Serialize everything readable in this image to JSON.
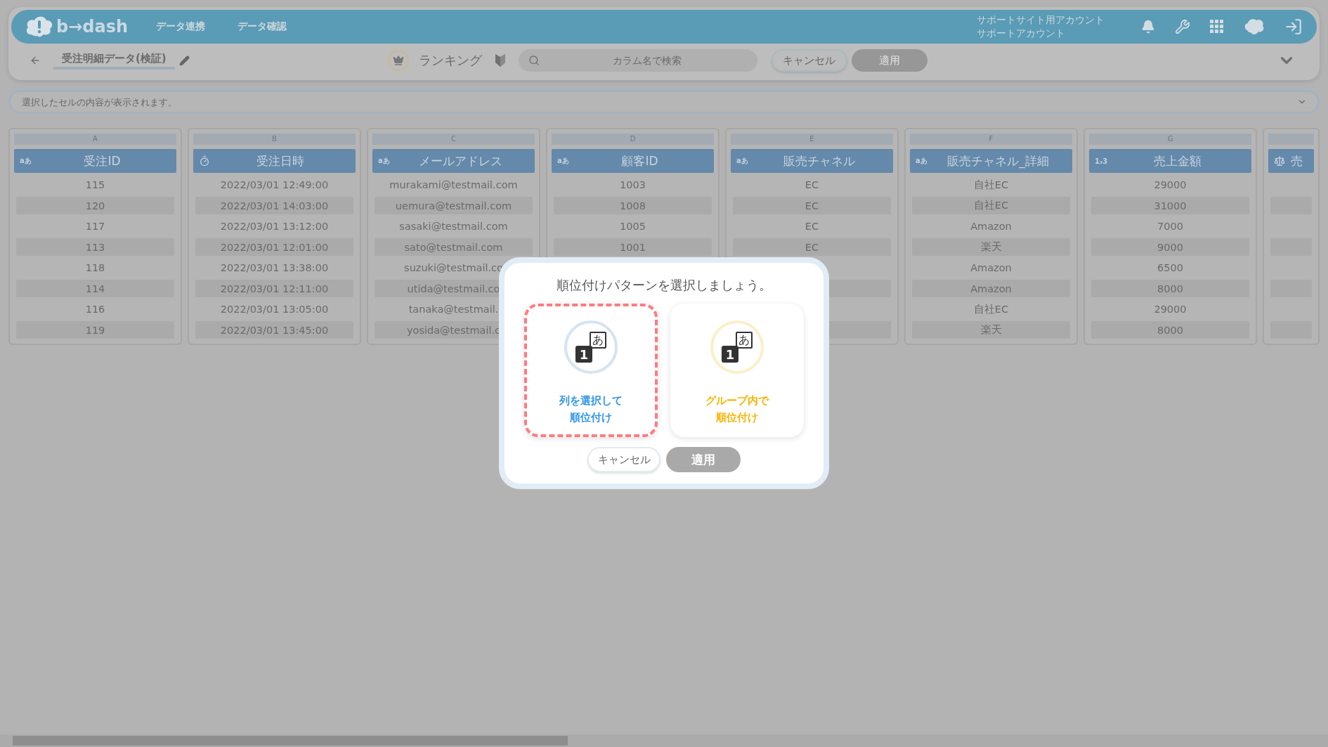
{
  "header": {
    "logo_text": "b→dash",
    "nav": [
      "データ連携",
      "データ確認"
    ],
    "account": [
      "サポートサイト用アカウント",
      "サポートアカウント"
    ]
  },
  "toolbar": {
    "title": "受注明細データ(検証)",
    "mode": "ランキング",
    "search": {
      "placeholder": "カラム名で検索"
    },
    "buttons": [
      {
        "label": "キャンセル",
        "disabled": false
      },
      {
        "label": "適用",
        "disabled": true
      }
    ]
  },
  "cell_preview": {
    "placeholder": "選択したセルの内容が表示されます。"
  },
  "table": {
    "columns": [
      {
        "letter": "A",
        "name": "受注ID",
        "kind": "text",
        "badge": "aあ",
        "cells": [
          "115",
          "120",
          "117",
          "113",
          "118",
          "114",
          "116",
          "119"
        ]
      },
      {
        "letter": "B",
        "name": "受注日時",
        "kind": "datetime",
        "cells": [
          "2022/03/01 12:49:00",
          "2022/03/01 14:03:00",
          "2022/03/01 13:12:00",
          "2022/03/01 12:01:00",
          "2022/03/01 13:38:00",
          "2022/03/01 12:11:00",
          "2022/03/01 13:05:00",
          "2022/03/01 13:45:00"
        ]
      },
      {
        "letter": "C",
        "name": "メールアドレス",
        "kind": "text",
        "badge": "aあ",
        "cells": [
          "murakami@testmail.com",
          "uemura@testmail.com",
          "sasaki@testmail.com",
          "sato@testmail.com",
          "suzuki@testmail.co",
          "utida@testmail.co",
          "tanaka@testmail.",
          "yosida@testmail.c"
        ]
      },
      {
        "letter": "D",
        "name": "顧客ID",
        "kind": "text",
        "badge": "aあ",
        "cells": [
          "1003",
          "1008",
          "1005",
          "1001"
        ]
      },
      {
        "letter": "E",
        "name": "販売チャネル",
        "kind": "text",
        "badge": "aあ",
        "cells": [
          "EC",
          "EC",
          "EC",
          "EC",
          null,
          null,
          null,
          null
        ]
      },
      {
        "letter": "F",
        "name": "販売チャネル_詳細",
        "kind": "text",
        "badge": "aあ",
        "cells": [
          "自社EC",
          "自社EC",
          "Amazon",
          "楽天",
          "Amazon",
          "Amazon",
          "自社EC",
          "楽天"
        ]
      },
      {
        "letter": "G",
        "name": "売上金額",
        "kind": "number",
        "badge": "1₂3",
        "cells": [
          "29000",
          "31000",
          "7000",
          "9000",
          "6500",
          "8000",
          "29000",
          "8000"
        ]
      },
      {
        "name": "売",
        "kind": "ratio",
        "cells": [
          null,
          null,
          null,
          null,
          null,
          null,
          null,
          null
        ]
      }
    ]
  },
  "modal": {
    "title": "順位付けパターンを選択しましょう。",
    "options": [
      {
        "label_lines": [
          "列を選択して",
          "順位付け"
        ],
        "color": "#2f95e8",
        "icon_number": "1",
        "icon_kana": "あ",
        "selected": true
      },
      {
        "label_lines": [
          "グループ内で",
          "順位付け"
        ],
        "color": "#f5b400",
        "icon_number": "1",
        "icon_kana": "あ",
        "selected": false
      }
    ],
    "buttons": [
      {
        "label": "キャンセル",
        "disabled": false
      },
      {
        "label": "適用",
        "disabled": true
      }
    ]
  }
}
